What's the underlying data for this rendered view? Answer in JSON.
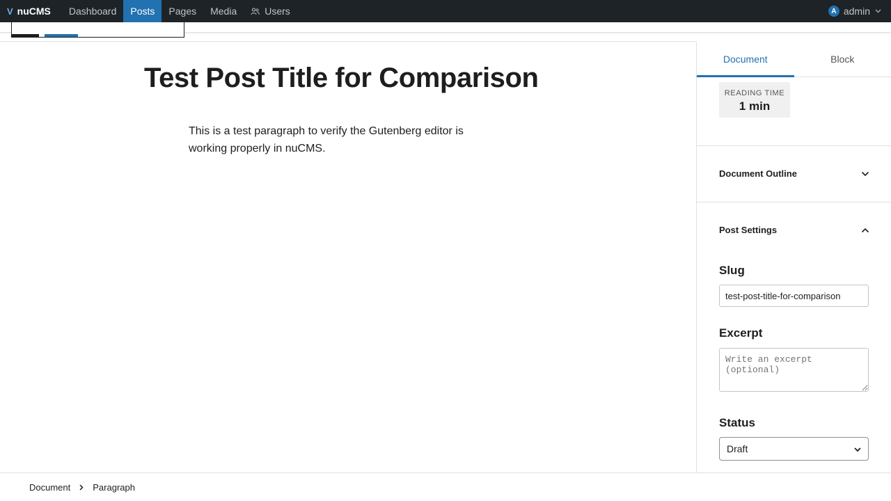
{
  "adminbar": {
    "brand": "nuCMS",
    "nav": [
      {
        "label": "Dashboard"
      },
      {
        "label": "Posts"
      },
      {
        "label": "Pages"
      },
      {
        "label": "Media"
      },
      {
        "label": "Users"
      }
    ],
    "user": {
      "avatar": "A",
      "name": "admin"
    }
  },
  "editor": {
    "title": "Test Post Title for Comparison",
    "paragraph": "This is a test paragraph to verify the Gutenberg editor is working properly in nuCMS."
  },
  "sidebar": {
    "tabs": [
      {
        "label": "Document"
      },
      {
        "label": "Block"
      }
    ],
    "reading_time": {
      "label": "READING TIME",
      "value": "1 min"
    },
    "outline": {
      "label": "Document Outline"
    },
    "post_settings": {
      "label": "Post Settings"
    },
    "slug": {
      "label": "Slug",
      "value": "test-post-title-for-comparison"
    },
    "excerpt": {
      "label": "Excerpt",
      "placeholder": "Write an excerpt (optional)"
    },
    "status": {
      "label": "Status",
      "value": "Draft"
    }
  },
  "breadcrumb": [
    {
      "label": "Document"
    },
    {
      "label": "Paragraph"
    }
  ],
  "colors": {
    "accent": "#2271b1",
    "adminbar": "#1d2327"
  }
}
